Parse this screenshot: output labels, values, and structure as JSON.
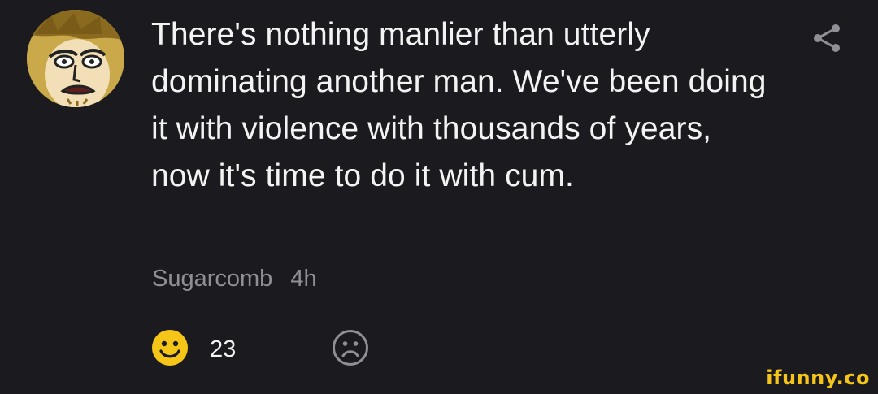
{
  "comment": {
    "text": "There's nothing manlier than utterly dominating another man. We've been doing it with violence with thousands of years, now it's time to do it with cum.",
    "author": "Sugarcomb",
    "time": "4h"
  },
  "reactions": {
    "like_count": "23",
    "like_icon": "smiley-face-icon",
    "dislike_icon": "frown-face-icon",
    "like_color": "#f5c518",
    "dislike_color": "#8f8f96"
  },
  "actions": {
    "share_icon": "share-icon"
  },
  "watermark": {
    "text": "ifunny.co",
    "color": "#f5c518"
  }
}
